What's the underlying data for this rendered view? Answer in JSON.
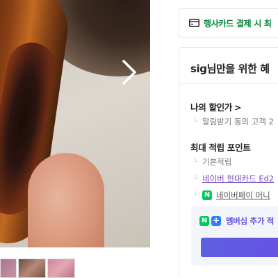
{
  "gallery": {
    "image_alt": "",
    "next_icon": "chevron-right-icon",
    "thumbnails": [
      "",
      "",
      ""
    ]
  },
  "card_banner": {
    "icon": "credit-card-icon",
    "label": "행사카드 결제 시 최"
  },
  "benefit": {
    "title": "sig님만을 위한 혜",
    "discount": {
      "title": "나의 할인가",
      "chevron": ">",
      "desc": "알림받기 동의 고객 2"
    },
    "points": {
      "title": "최대 적립 포인트",
      "basic": "기본적립",
      "hyundai_card": "네이버 현대카드 Ed2",
      "npay_money": "네이버페이 머니"
    },
    "membership": {
      "label": "멤버십 추가 적",
      "button_label": ""
    }
  },
  "colors": {
    "green": "#0a8a3c",
    "naver_green": "#03c75a",
    "purple": "#5b4fd6",
    "link_purple": "#7a4fbf"
  }
}
